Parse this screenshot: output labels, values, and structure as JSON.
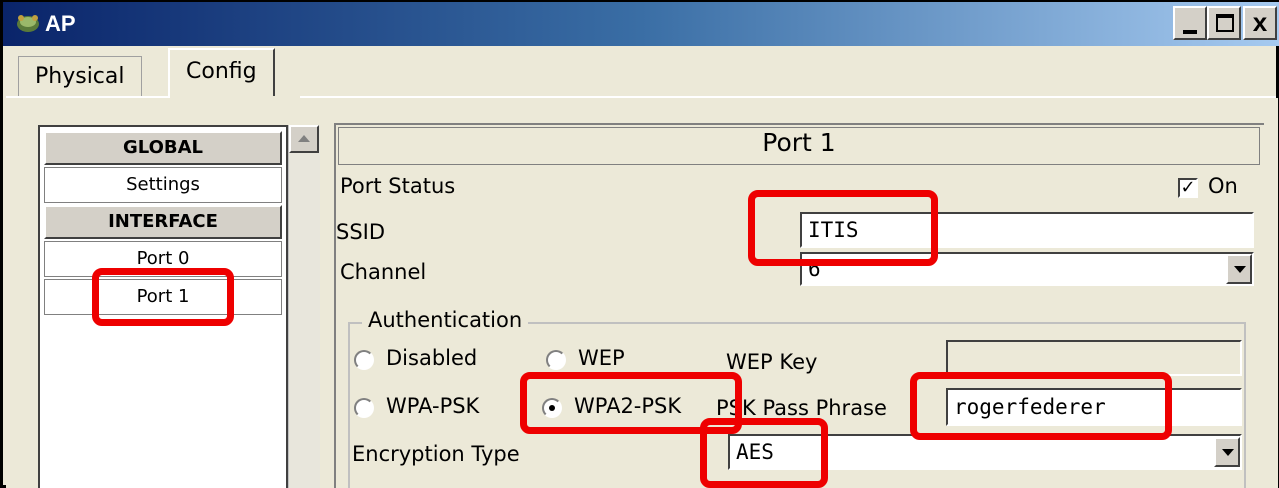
{
  "window": {
    "title": "AP"
  },
  "tabs": [
    {
      "label": "Physical"
    },
    {
      "label": "Config"
    }
  ],
  "sidebar": {
    "items": [
      {
        "label": "GLOBAL",
        "type": "header"
      },
      {
        "label": "Settings",
        "type": "item"
      },
      {
        "label": "INTERFACE",
        "type": "header"
      },
      {
        "label": "Port 0",
        "type": "item"
      },
      {
        "label": "Port 1",
        "type": "item",
        "selected": true
      }
    ]
  },
  "port": {
    "title": "Port 1",
    "status_label": "Port Status",
    "status_checked": true,
    "status_on_label": "On",
    "ssid_label": "SSID",
    "ssid_value": "ITIS",
    "channel_label": "Channel",
    "channel_value": "6"
  },
  "auth": {
    "legend": "Authentication",
    "options": [
      {
        "label": "Disabled",
        "selected": false
      },
      {
        "label": "WEP",
        "selected": false
      },
      {
        "label": "WPA-PSK",
        "selected": false
      },
      {
        "label": "WPA2-PSK",
        "selected": true
      }
    ],
    "wep_key_label": "WEP Key",
    "wep_key_value": "",
    "psk_label": "PSK Pass Phrase",
    "psk_value": "rogerfederer",
    "encryption_label": "Encryption Type",
    "encryption_value": "AES"
  },
  "colors": {
    "highlight": "#ee0000",
    "titlebar_start": "#0a246a",
    "titlebar_end": "#a6caf0"
  },
  "icons": {
    "app": "network-ap-icon",
    "minimize": "minimize-icon",
    "maximize": "maximize-icon",
    "close": "close-icon"
  }
}
